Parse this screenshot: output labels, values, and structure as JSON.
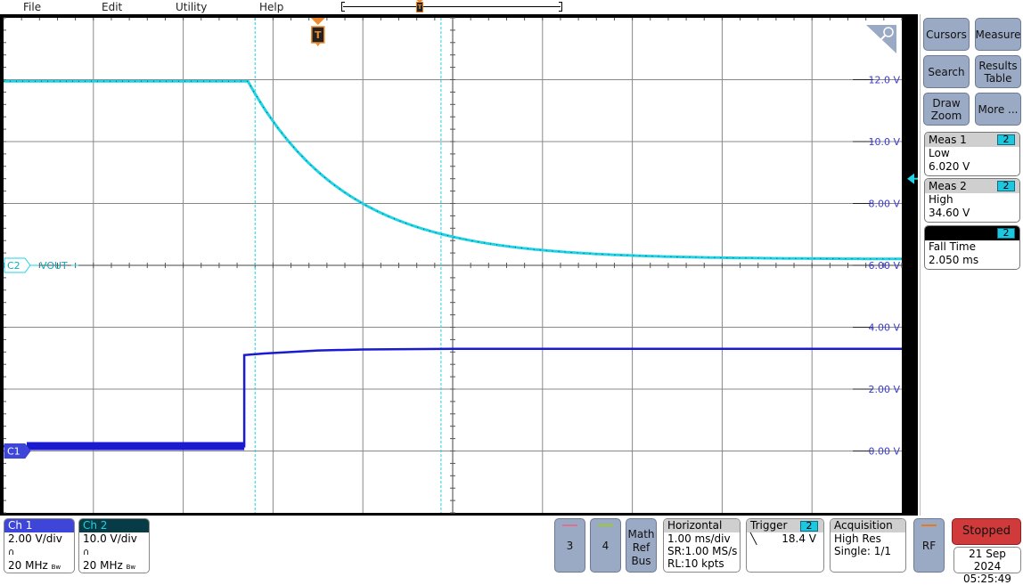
{
  "menu": {
    "items": [
      "File",
      "Edit",
      "Utility",
      "Help"
    ]
  },
  "trigger_marker": {
    "label": "T"
  },
  "colors": {
    "ch1": "#1a1ad0",
    "ch1_header": "#3d46d8",
    "ch2": "#1fd3e6",
    "ch2_header": "#073b45",
    "ch3": "#e07090",
    "ch4": "#9acb2a",
    "rf": "#e87a1e",
    "stopped": "#d03a3a",
    "grid": "#808080",
    "trigger": "#f08a2a"
  },
  "waveform": {
    "axis_labels": [
      "12.0 V",
      "10.0 V",
      "8.00 V",
      "6.00 V",
      "4.00 V",
      "2.00 V",
      "0.00 V"
    ],
    "axis_values": [
      12,
      10,
      8,
      6,
      4,
      2,
      0
    ],
    "h_divisions": 10,
    "v_divisions": 8,
    "ch1_marker": "C1",
    "ch2_marker": "C2",
    "ch2_label": "VOUT",
    "ch1_trace": {
      "description": "Step from ~0 V to ~3.3 V at ~2.7 div",
      "points": [
        [
          0,
          0.15
        ],
        [
          2.68,
          0.15
        ],
        [
          2.68,
          3.1
        ],
        [
          2.9,
          3.15
        ],
        [
          3.5,
          3.25
        ],
        [
          4.0,
          3.28
        ],
        [
          5.0,
          3.3
        ],
        [
          10.0,
          3.3
        ]
      ]
    },
    "ch2_trace": {
      "description": "Exponential decay from ~12 V to ~6.2 V starting at ~2.7 div",
      "start_div": 2.72,
      "high": 11.95,
      "low": 6.2,
      "tau_div": 1.1
    },
    "cursor_positions_div": [
      2.8,
      4.87
    ],
    "trigger_level_marker": "8.8"
  },
  "sidebar": {
    "buttons": [
      {
        "label": "Cursors"
      },
      {
        "label": "Measure"
      },
      {
        "label": "Search"
      },
      {
        "label": "Results Table"
      },
      {
        "label": "Draw Zoom"
      },
      {
        "label": "More ..."
      }
    ],
    "measurements": [
      {
        "title": "Meas 1",
        "source": "2",
        "type": "Low",
        "value": "6.020 V"
      },
      {
        "title": "Meas 2",
        "source": "2",
        "type": "High",
        "value": "34.60 V"
      },
      {
        "title": "",
        "source": "2",
        "type": "Fall Time",
        "value": "2.050 ms"
      }
    ]
  },
  "channels": [
    {
      "name": "Ch 1",
      "scale": "2.00 V/div",
      "bandwidth": "20 MHz",
      "bw_suffix": "Bw"
    },
    {
      "name": "Ch 2",
      "scale": "10.0 V/div",
      "bandwidth": "20 MHz",
      "bw_suffix": "Bw"
    }
  ],
  "bottom_buttons": {
    "ch3": "3",
    "ch4": "4",
    "math": [
      "Math",
      "Ref",
      "Bus"
    ],
    "rf": "RF"
  },
  "horizontal": {
    "title": "Horizontal",
    "scale": "1.00 ms/div",
    "sample_rate": "SR:1.00 MS/s",
    "record_length": "RL:10 kpts"
  },
  "trigger": {
    "title": "Trigger",
    "source": "2",
    "slope": "falling",
    "level": "18.4 V"
  },
  "acquisition": {
    "title": "Acquisition",
    "mode": "High Res",
    "state": "Single: 1/1"
  },
  "run_state": "Stopped",
  "date": "21 Sep 2024",
  "time": "05:25:49"
}
